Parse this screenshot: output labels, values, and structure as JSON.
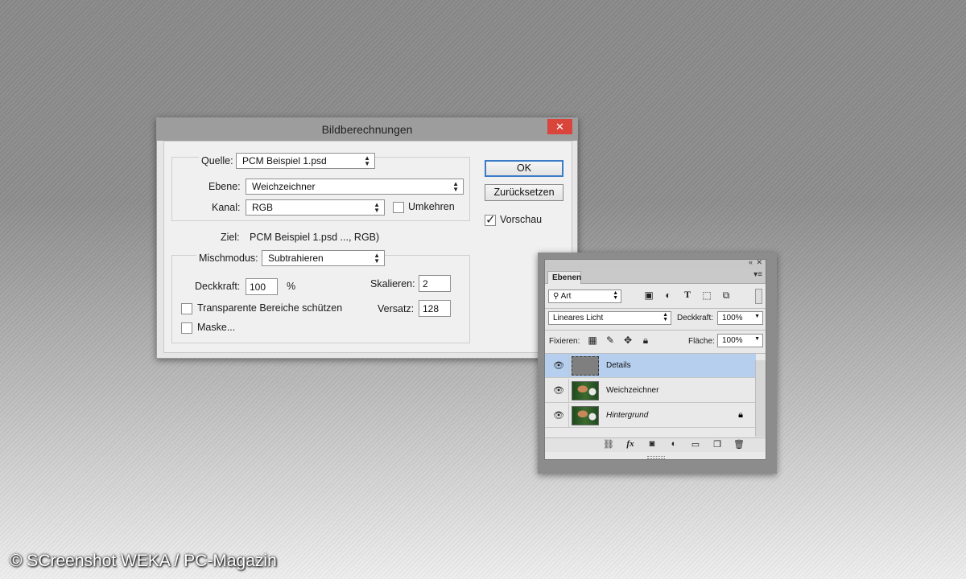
{
  "dialog": {
    "title": "Bildberechnungen",
    "close_label": "✕",
    "source_label": "Quelle:",
    "source_value": "PCM Beispiel 1.psd",
    "layer_label": "Ebene:",
    "layer_value": "Weichzeichner",
    "channel_label": "Kanal:",
    "channel_value": "RGB",
    "invert_label": "Umkehren",
    "target_label": "Ziel:",
    "target_value": "PCM Beispiel 1.psd ..., RGB)",
    "blend_label": "Mischmodus:",
    "blend_value": "Subtrahieren",
    "opacity_label": "Deckkraft:",
    "opacity_value": "100",
    "opacity_unit": "%",
    "preserve_label": "Transparente Bereiche schützen",
    "mask_label": "Maske...",
    "scale_label": "Skalieren:",
    "scale_value": "2",
    "offset_label": "Versatz:",
    "offset_value": "128",
    "ok_label": "OK",
    "reset_label": "Zurücksetzen",
    "preview_label": "Vorschau",
    "preview_checked": true,
    "invert_checked": false,
    "preserve_checked": false,
    "mask_checked": false
  },
  "layers_panel": {
    "collapse_icon": "«",
    "close_icon": "✕",
    "tab_label": "Ebenen",
    "menu_icon": "▾≡",
    "filter_value": "Art",
    "blend_mode": "Lineares Licht",
    "opacity_label": "Deckkraft:",
    "opacity_value": "100%",
    "lock_label": "Fixieren:",
    "fill_label": "Fläche:",
    "fill_value": "100%",
    "layers": [
      {
        "name": "Details",
        "selected": true,
        "italic": false,
        "locked": false
      },
      {
        "name": "Weichzeichner",
        "selected": false,
        "italic": false,
        "locked": false
      },
      {
        "name": "Hintergrund",
        "selected": false,
        "italic": true,
        "locked": true
      }
    ]
  },
  "watermark": "© SCreenshot WEKA / PC-Magazin"
}
